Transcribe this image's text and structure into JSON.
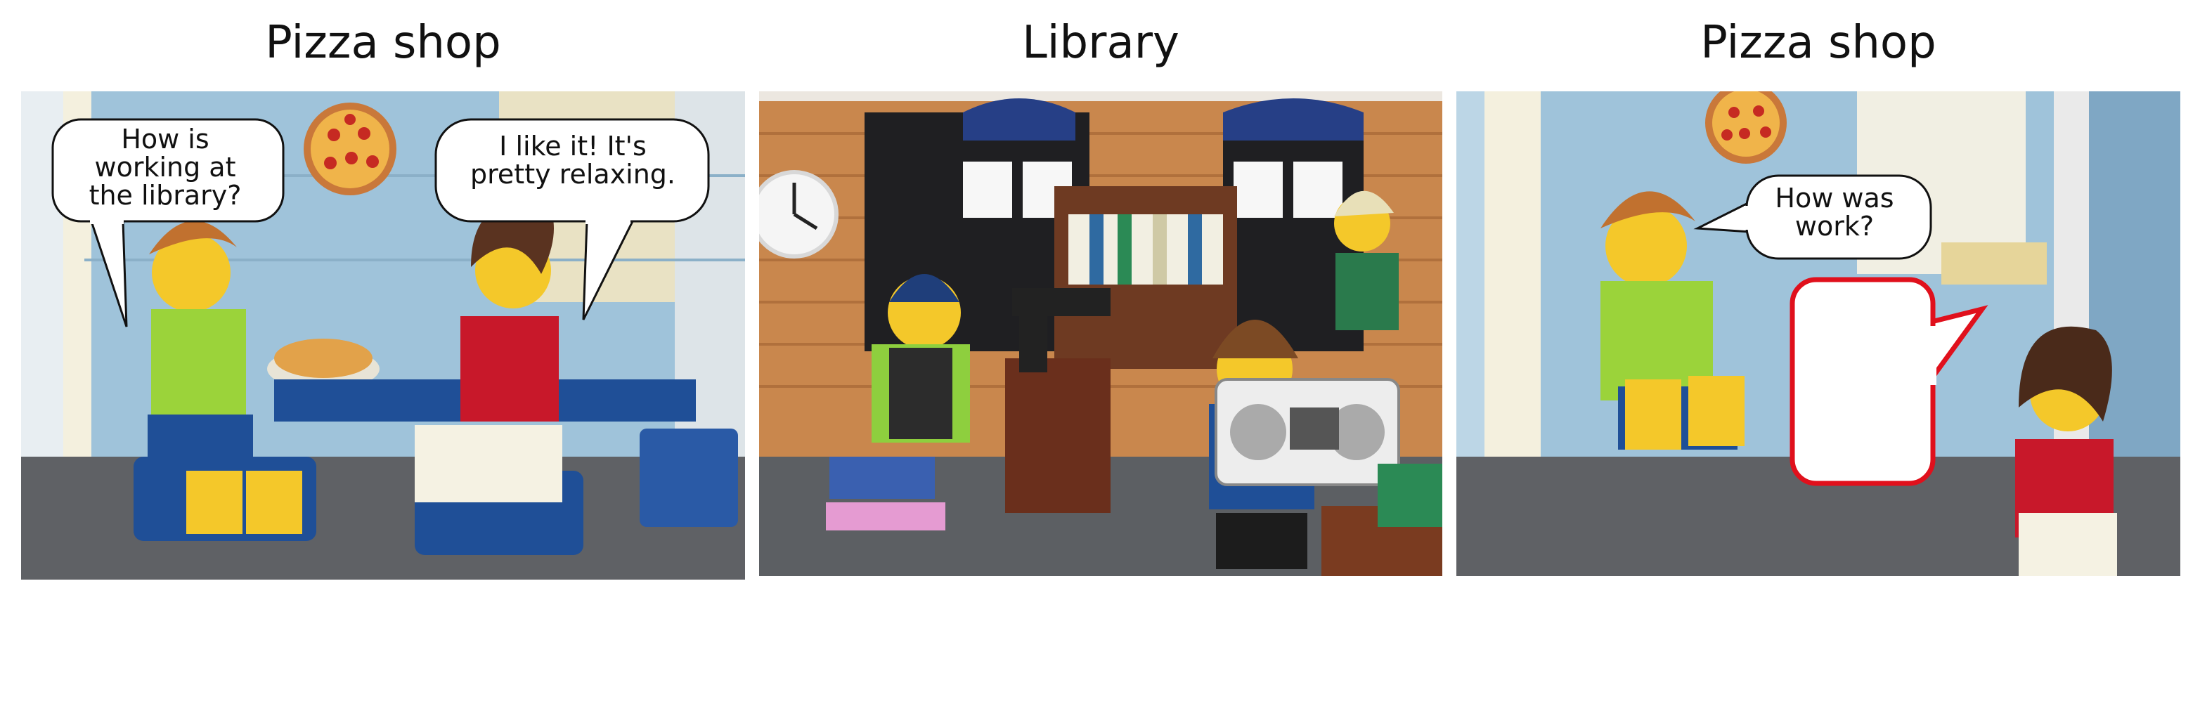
{
  "panels": [
    {
      "title": "Pizza shop",
      "bubbles": [
        {
          "text": "How is working at the library?"
        },
        {
          "text": "I like it! It's pretty relaxing."
        }
      ]
    },
    {
      "title": "Library",
      "bubbles": []
    },
    {
      "title": "Pizza shop",
      "bubbles": [
        {
          "text": "How was work?"
        },
        {
          "text": ""
        }
      ]
    }
  ],
  "colors": {
    "wall_blue": "#9fc3da",
    "baseplate_gray": "#5f6165",
    "minifig_yellow": "#f4c82a",
    "shirt_green": "#9bd33a",
    "shirt_red": "#c8182a",
    "library_wall": "#c9874d",
    "empty_bubble_border": "#e0101c"
  },
  "icons": [
    "pizza-decoration",
    "wall-clock",
    "boombox",
    "speech-bubble"
  ]
}
